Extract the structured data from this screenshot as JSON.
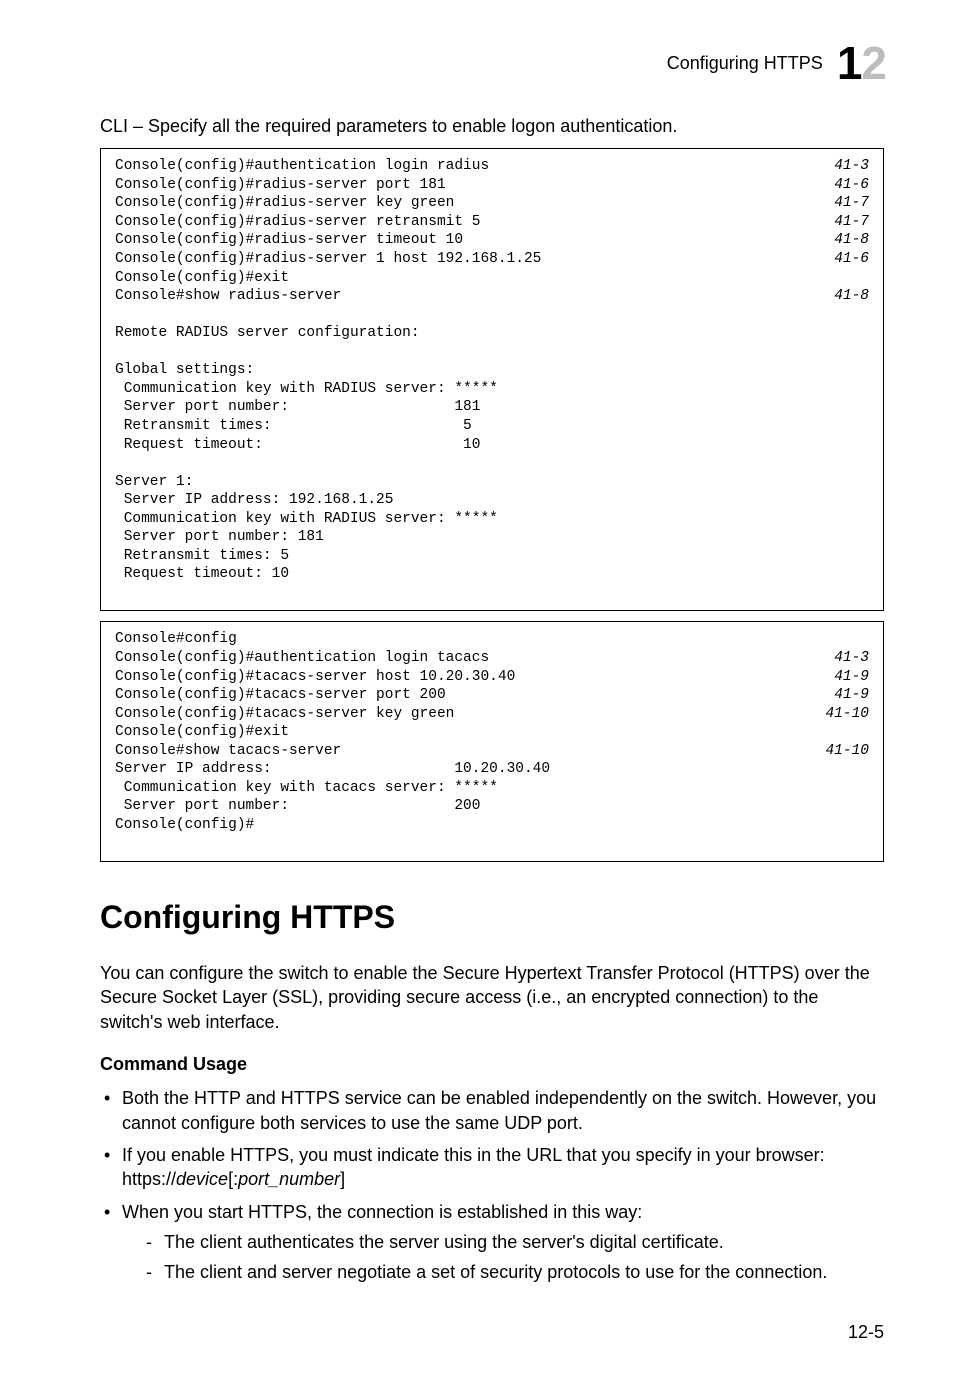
{
  "header": {
    "title": "Configuring HTTPS",
    "pagenum_big": "12"
  },
  "lead": "CLI – Specify all the required parameters to enable logon authentication.",
  "code1": {
    "lines": [
      {
        "t": "Console(config)#authentication login radius",
        "r": "41-3"
      },
      {
        "t": "Console(config)#radius-server port 181",
        "r": "41-6"
      },
      {
        "t": "Console(config)#radius-server key green",
        "r": "41-7"
      },
      {
        "t": "Console(config)#radius-server retransmit 5",
        "r": "41-7"
      },
      {
        "t": "Console(config)#radius-server timeout 10",
        "r": "41-8"
      },
      {
        "t": "Console(config)#radius-server 1 host 192.168.1.25",
        "r": "41-6"
      },
      {
        "t": "Console(config)#exit",
        "r": ""
      },
      {
        "t": "Console#show radius-server",
        "r": "41-8"
      },
      {
        "t": "",
        "r": ""
      },
      {
        "t": "Remote RADIUS server configuration:",
        "r": ""
      },
      {
        "t": "",
        "r": ""
      },
      {
        "t": "Global settings:",
        "r": ""
      },
      {
        "t": " Communication key with RADIUS server: *****",
        "r": ""
      },
      {
        "t": " Server port number:                   181",
        "r": ""
      },
      {
        "t": " Retransmit times:                      5",
        "r": ""
      },
      {
        "t": " Request timeout:                       10",
        "r": ""
      },
      {
        "t": "",
        "r": ""
      },
      {
        "t": "Server 1:",
        "r": ""
      },
      {
        "t": " Server IP address: 192.168.1.25",
        "r": ""
      },
      {
        "t": " Communication key with RADIUS server: *****",
        "r": ""
      },
      {
        "t": " Server port number: 181",
        "r": ""
      },
      {
        "t": " Retransmit times: 5",
        "r": ""
      },
      {
        "t": " Request timeout: 10",
        "r": ""
      },
      {
        "t": "",
        "r": ""
      }
    ]
  },
  "code2": {
    "lines": [
      {
        "t": "Console#config",
        "r": ""
      },
      {
        "t": "Console(config)#authentication login tacacs",
        "r": "41-3"
      },
      {
        "t": "Console(config)#tacacs-server host 10.20.30.40",
        "r": "41-9"
      },
      {
        "t": "Console(config)#tacacs-server port 200",
        "r": "41-9"
      },
      {
        "t": "Console(config)#tacacs-server key green",
        "r": "41-10"
      },
      {
        "t": "Console(config)#exit",
        "r": ""
      },
      {
        "t": "Console#show tacacs-server",
        "r": "41-10"
      },
      {
        "t": "Server IP address:                     10.20.30.40",
        "r": ""
      },
      {
        "t": " Communication key with tacacs server: *****",
        "r": ""
      },
      {
        "t": " Server port number:                   200",
        "r": ""
      },
      {
        "t": "Console(config)#",
        "r": ""
      },
      {
        "t": "",
        "r": ""
      }
    ]
  },
  "section_heading": "Configuring HTTPS",
  "intro_para": "You can configure the switch to enable the Secure Hypertext Transfer Protocol (HTTPS) over the Secure Socket Layer (SSL), providing secure access (i.e., an encrypted connection) to the switch's web interface.",
  "cmd_usage_label": "Command Usage",
  "bullets": {
    "b1": "Both the HTTP and HTTPS service can be enabled independently on the switch. However, you cannot configure both services to use the same UDP port.",
    "b2_pre": "If you enable HTTPS, you must indicate this in the URL that you specify in your browser: https://",
    "b2_dev": "device",
    "b2_mid": "[:",
    "b2_port": "port_number",
    "b2_post": "]",
    "b3": "When you start HTTPS, the connection is established in this way:",
    "d1": "The client authenticates the server using the server's digital certificate.",
    "d2": "The client and server negotiate a set of security protocols to use for the connection."
  },
  "footer_page": "12-5"
}
